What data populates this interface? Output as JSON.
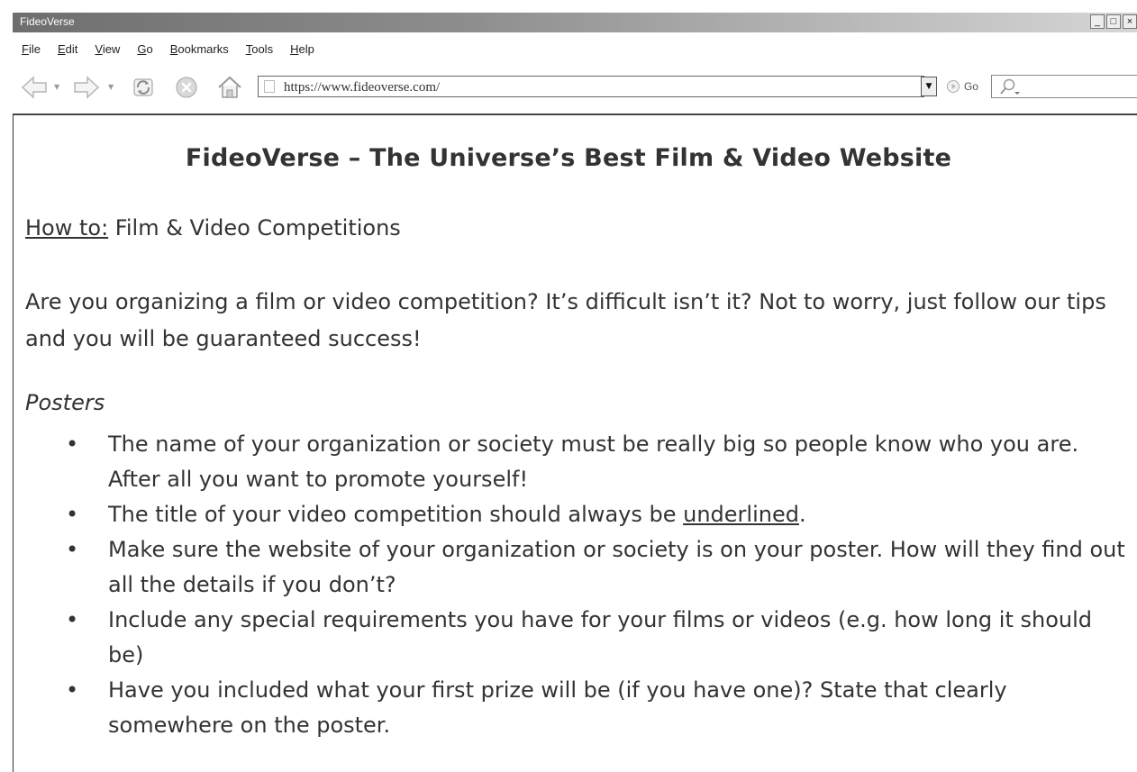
{
  "window": {
    "title": "FideoVerse",
    "controls": {
      "minimize": "_",
      "maximize": "□",
      "close": "×"
    }
  },
  "menu": {
    "items": [
      {
        "first": "F",
        "rest": "ile"
      },
      {
        "first": "E",
        "rest": "dit"
      },
      {
        "first": "V",
        "rest": "iew"
      },
      {
        "first": "G",
        "rest": "o"
      },
      {
        "first": "B",
        "rest": "ookmarks"
      },
      {
        "first": "T",
        "rest": "ools"
      },
      {
        "first": "H",
        "rest": "elp"
      }
    ]
  },
  "toolbar": {
    "address": "https://www.fideoverse.com/",
    "go_label": "Go",
    "search_value": ""
  },
  "page": {
    "site_title": "FideoVerse – The Universe’s Best Film & Video Website",
    "howto_label": "How to:",
    "howto_text": " Film & Video Competitions",
    "intro": "Are you organizing a film or video competition? It’s difficult isn’t it? Not to worry, just follow our tips and you will be guaranteed success!",
    "section_title": "Posters",
    "bullet_mark": "•",
    "bullets": {
      "b1": "The name of your organization or society must be really big so people know who you are. After all you want to promote yourself!",
      "b2_before": "The title of your video competition should always be ",
      "b2_underlined": "underlined",
      "b2_after": ".",
      "b3": "Make sure the website of your organization or society is on your poster. How will they find out all the details if you don’t?",
      "b4": "Include any special requirements you have for your films or videos (e.g. how long it should be)",
      "b5": "Have you included what your first prize will be (if you have one)? State that clearly somewhere on the poster."
    }
  },
  "icons": {
    "back": "back-arrow-icon",
    "forward": "forward-arrow-icon",
    "refresh": "refresh-icon",
    "stop": "stop-icon",
    "home": "home-icon",
    "go": "go-icon",
    "search": "search-icon"
  }
}
